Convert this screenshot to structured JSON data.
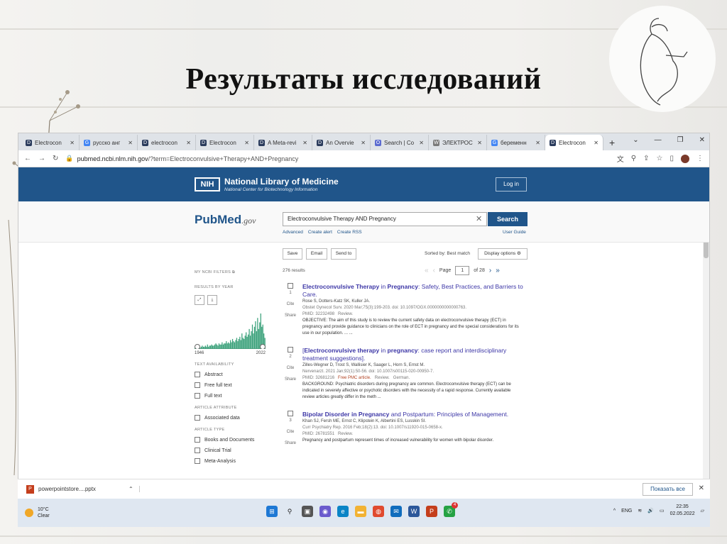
{
  "slide": {
    "title": "Результаты исследований"
  },
  "browser": {
    "tabs": [
      {
        "label": "Electrocon",
        "icon": "d-icon",
        "active": false
      },
      {
        "label": "русско анг",
        "icon": "g-icon",
        "active": false
      },
      {
        "label": "electrocon",
        "icon": "d-icon",
        "active": false
      },
      {
        "label": "Electrocon",
        "icon": "d-icon",
        "active": false
      },
      {
        "label": "A Meta-revi",
        "icon": "d-icon",
        "active": false
      },
      {
        "label": "An Overvie",
        "icon": "d-icon",
        "active": false
      },
      {
        "label": "Search | Co",
        "icon": "o-icon",
        "active": false
      },
      {
        "label": "ЭЛЕКТРОС",
        "icon": "w-icon",
        "active": false
      },
      {
        "label": "беременн",
        "icon": "g-icon",
        "active": false
      },
      {
        "label": "Electrocon",
        "icon": "d-icon",
        "active": true
      }
    ],
    "url": {
      "host": "pubmed.ncbi.nlm.nih.gov",
      "path": "/?term=Electroconvulsive+Therapy+AND+Pregnancy"
    }
  },
  "nih": {
    "badge": "NIH",
    "name": "National Library of Medicine",
    "subtitle": "National Center for Biotechnology Information",
    "login": "Log in"
  },
  "pubmed": {
    "logo_main": "PubMed",
    "logo_suffix": ".gov",
    "search_value": "Electroconvulsive Therapy AND Pregnancy",
    "search_button": "Search",
    "links": [
      "Advanced",
      "Create alert",
      "Create RSS"
    ],
    "user_guide": "User Guide",
    "toolbar": {
      "save": "Save",
      "email": "Email",
      "send_to": "Send to",
      "sorted_by": "Sorted by: Best match",
      "display_options": "Display options"
    }
  },
  "filters": {
    "my_ncbi": "MY NCBI FILTERS",
    "results_by_year": "RESULTS BY YEAR",
    "year_start": "1946",
    "year_end": "2022",
    "text_availability": "TEXT AVAILABILITY",
    "text_items": [
      "Abstract",
      "Free full text",
      "Full text"
    ],
    "article_attribute": "ARTICLE ATTRIBUTE",
    "attribute_items": [
      "Associated data"
    ],
    "article_type": "ARTICLE TYPE",
    "type_items": [
      "Books and Documents",
      "Clinical Trial",
      "Meta-Analysis"
    ]
  },
  "histogram": [
    1,
    1,
    2,
    1,
    2,
    1,
    2,
    3,
    2,
    2,
    3,
    2,
    4,
    2,
    3,
    3,
    4,
    3,
    3,
    4,
    5,
    4,
    3,
    5,
    4,
    4,
    6,
    4,
    5,
    5,
    7,
    5,
    6,
    5,
    8,
    6,
    9,
    7,
    6,
    8,
    10,
    7,
    9,
    11,
    8,
    14,
    10,
    9,
    12,
    15,
    11,
    13,
    18,
    12,
    16,
    22,
    14,
    20,
    25,
    16,
    28,
    18,
    24,
    32,
    20,
    22,
    14,
    10
  ],
  "results": {
    "count": "276 results",
    "page_label": "Page",
    "page_value": "1",
    "page_of": "of 28",
    "articles": [
      {
        "num": "1",
        "title_pre": "",
        "title_b1": "Electroconvulsive Therapy",
        "title_mid": " in ",
        "title_b2": "Pregnancy",
        "title_post": ": Safety, Best Practices, and Barriers to Care.",
        "authors": "Rose S, Dotters-Katz SK, Kuller JA.",
        "journal": "Obstet Gynecol Surv. 2020 Mar;75(3):199-203. doi: 10.1097/OGX.0000000000000763.",
        "pmid": "PMID: 32232498",
        "free": "",
        "tag": "Review.",
        "lang": "",
        "snippet": "OBJECTIVE: The aim of this study is to review the current safety data on electroconvulsive therapy (ECT) in pregnancy and provide guidance to clinicians on the role of ECT in pregnancy and the special considerations for its use in our population. ... ..."
      },
      {
        "num": "2",
        "title_pre": "[",
        "title_b1": "Electroconvulsive therapy",
        "title_mid": " in ",
        "title_b2": "pregnancy",
        "title_post": ": case report and interdisciplinary treatment suggestions].",
        "authors": "Zilles-Wegner D, Trost S, Wallisier K, Saager L, Horn S, Ernst M.",
        "journal": "Nervenarzt. 2021 Jan;92(1):50-56. doi: 10.1007/s00115-020-00950-7.",
        "pmid": "PMID: 32681216",
        "free": "Free PMC article.",
        "tag": "Review.",
        "lang": "German.",
        "snippet": "BACKGROUND: Psychiatric disorders during pregnancy are common. Electroconvulsive therapy (ECT) can be indicated in severely affective or psychotic disorders with the necessity of a rapid response. Currently available review articles greatly differ in the meth ..."
      },
      {
        "num": "3",
        "title_pre": "",
        "title_b1": "Bipolar Disorder in ",
        "title_mid": "",
        "title_b2": "Pregnancy",
        "title_post": " and Postpartum: Principles of Management.",
        "authors": "Khan SJ, Fersh ME, Ernst C, Klipstein K, Albertini ES, Lusskin SI.",
        "journal": "Curr Psychiatry Rep. 2016 Feb;18(2):13. doi: 10.1007/s11920-015-0658-x.",
        "pmid": "PMID: 26781551",
        "free": "",
        "tag": "Review.",
        "lang": "",
        "snippet": "Pregnancy and postpartum represent times of increased vulnerability for women with bipolar disorder."
      }
    ],
    "cite": "Cite",
    "share": "Share"
  },
  "download_bar": {
    "file": "powerpointstore....pptx",
    "show_all": "Показать все"
  },
  "taskbar": {
    "temp": "10°C",
    "weather": "Clear",
    "lang": "ENG",
    "time": "22:35",
    "date": "02.05.2022",
    "mail_badge": "4"
  }
}
